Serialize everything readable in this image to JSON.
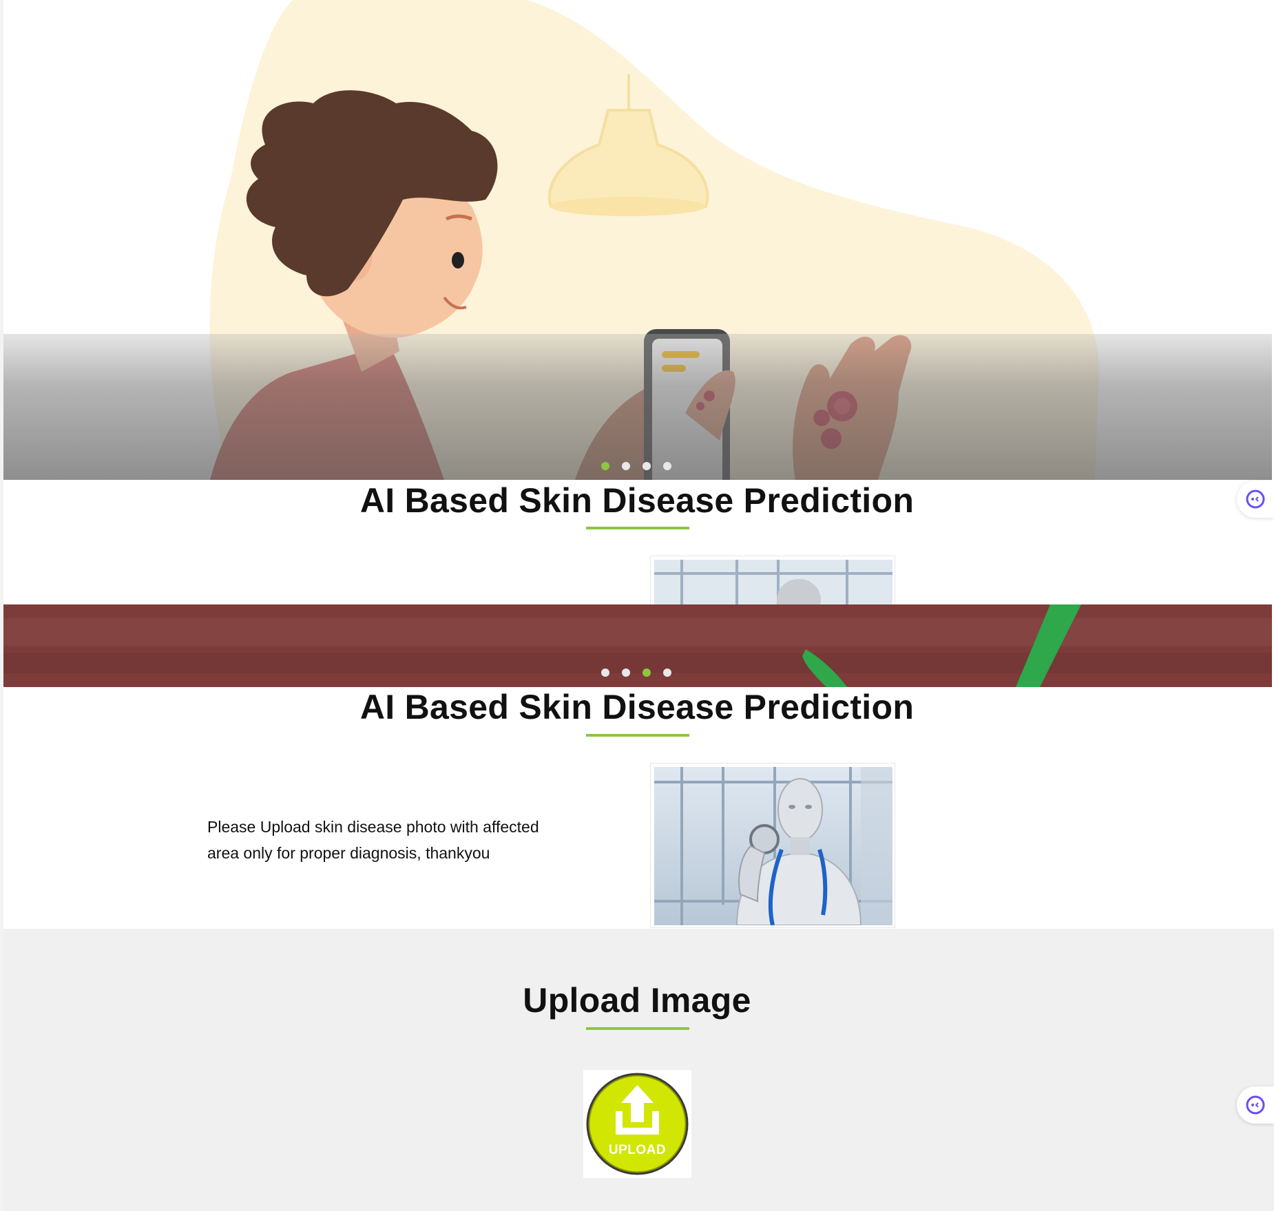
{
  "hero_slider_1": {
    "dots": [
      {
        "active": true
      },
      {
        "active": false
      },
      {
        "active": false
      },
      {
        "active": false
      }
    ]
  },
  "section_1": {
    "title": "AI Based Skin Disease Prediction"
  },
  "hero_slider_2": {
    "dots": [
      {
        "active": false
      },
      {
        "active": false
      },
      {
        "active": true
      },
      {
        "active": false
      }
    ]
  },
  "section_2": {
    "title": "AI Based Skin Disease Prediction",
    "description": "Please Upload skin disease photo with affected area only for proper diagnosis, thankyou"
  },
  "upload": {
    "title": "Upload Image",
    "button_label": "UPLOAD"
  },
  "colors": {
    "accent_green": "#8dc63f",
    "upload_yellow_green": "#c8e000",
    "section_gray": "#f0f0f0"
  },
  "icons": {
    "side_widget": "assistant-face-icon",
    "upload": "upload-arrow-icon"
  }
}
